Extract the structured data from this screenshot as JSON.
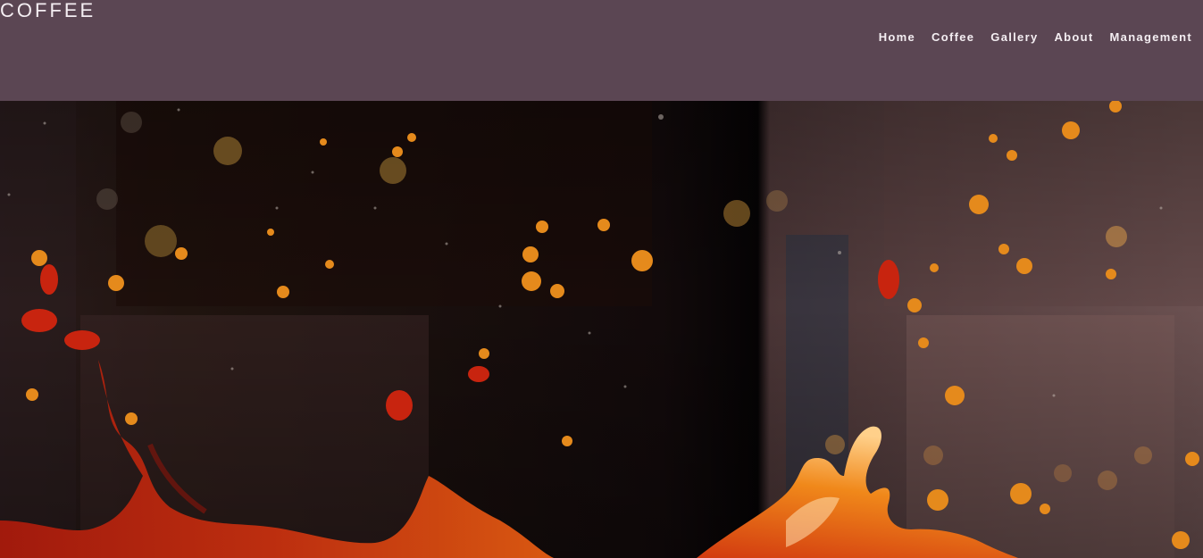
{
  "brand": {
    "title": "COFFEE"
  },
  "nav": {
    "items": [
      {
        "label": "Home"
      },
      {
        "label": "Coffee"
      },
      {
        "label": "Gallery"
      },
      {
        "label": "About"
      },
      {
        "label": "Management"
      }
    ]
  },
  "hero": {
    "image_subject": "coffee-splash-photo",
    "colors": {
      "background_dark": "#1a0f10",
      "background_right": "#6a4f4e",
      "splash_red": "#b3200f",
      "splash_orange": "#e06a10"
    }
  }
}
